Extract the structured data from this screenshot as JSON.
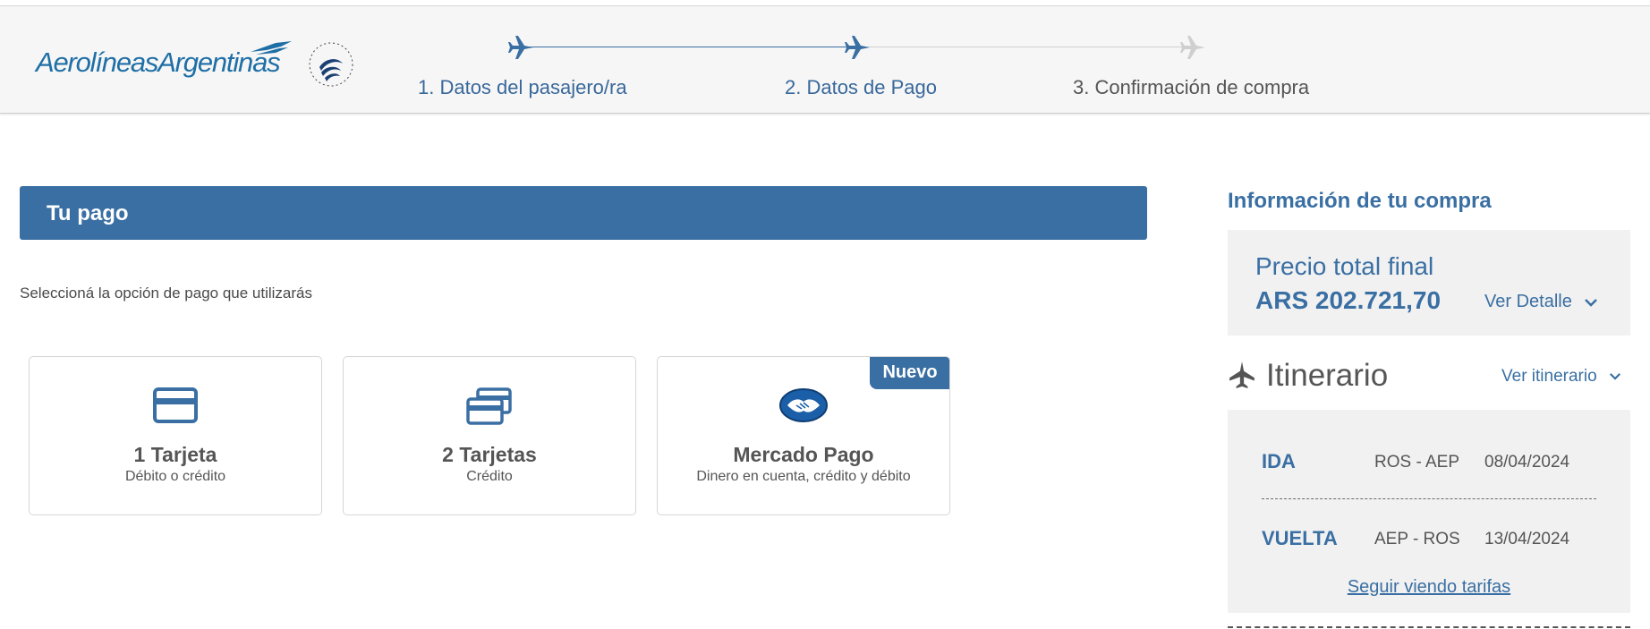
{
  "header": {
    "logo_text": "AerolíneasArgentinas",
    "alliance_logo": "skyteam-logo",
    "steps": [
      {
        "label": "1. Datos del pasajero/ra",
        "status": "completed"
      },
      {
        "label": "2. Datos de Pago",
        "status": "current"
      },
      {
        "label": "3. Confirmación de compra",
        "status": "pending"
      }
    ]
  },
  "payment": {
    "section_title": "Tu pago",
    "instruction": "Seleccioná la opción de pago que utilizarás",
    "options": [
      {
        "icon": "credit-card-icon",
        "title": "1 Tarjeta",
        "subtitle": "Débito o crédito"
      },
      {
        "icon": "two-cards-icon",
        "title": "2 Tarjetas",
        "subtitle": "Crédito"
      },
      {
        "icon": "mercado-pago-icon",
        "title": "Mercado Pago",
        "subtitle": "Dinero en cuenta, crédito y débito",
        "badge": "Nuevo"
      }
    ]
  },
  "summary": {
    "title": "Información de tu compra",
    "price_label": "Precio total final",
    "price_amount": "ARS 202.721,70",
    "detail_link": "Ver Detalle",
    "itinerary_title": "Itinerario",
    "itinerary_link": "Ver itinerario",
    "legs": [
      {
        "type": "IDA",
        "route": "ROS - AEP",
        "date": "08/04/2024"
      },
      {
        "type": "VUELTA",
        "route": "AEP - ROS",
        "date": "13/04/2024"
      }
    ],
    "fares_link": "Seguir viendo tarifas"
  },
  "colors": {
    "brand_blue": "#3a6fa3",
    "logo_blue": "#1f6fa6",
    "inactive_step": "#cfcfcf"
  }
}
